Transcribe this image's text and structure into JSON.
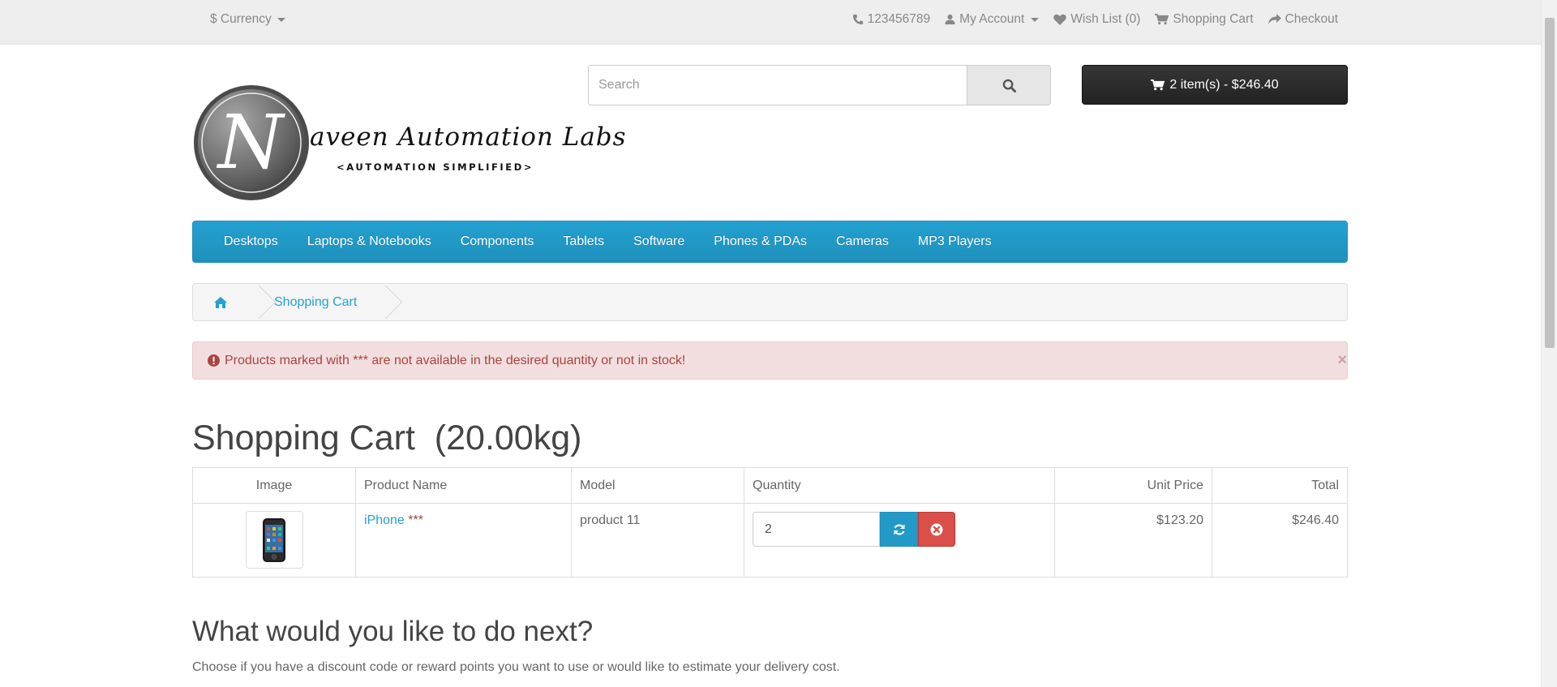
{
  "topbar": {
    "currency_label": "$ Currency",
    "phone": "123456789",
    "my_account": "My Account",
    "wish_list": "Wish List (0)",
    "shopping_cart": "Shopping Cart",
    "checkout": "Checkout"
  },
  "logo": {
    "letter": "N",
    "script_text": "aveen Automation Labs",
    "subtitle": "<AUTOMATION SIMPLIFIED>"
  },
  "search": {
    "placeholder": "Search"
  },
  "cart_button": {
    "label": "2 item(s) - $246.40"
  },
  "menu": {
    "items": [
      "Desktops",
      "Laptops & Notebooks",
      "Components",
      "Tablets",
      "Software",
      "Phones & PDAs",
      "Cameras",
      "MP3 Players"
    ]
  },
  "breadcrumb": {
    "current": "Shopping Cart"
  },
  "alert": {
    "message": "Products marked with *** are not available in the desired quantity or not in stock!",
    "close": "×"
  },
  "page": {
    "title": "Shopping Cart  (20.00kg)"
  },
  "cart_table": {
    "headers": {
      "image": "Image",
      "product_name": "Product Name",
      "model": "Model",
      "quantity": "Quantity",
      "unit_price": "Unit Price",
      "total": "Total"
    },
    "rows": [
      {
        "product_name": "iPhone",
        "stock_flag": "***",
        "model": "product 11",
        "quantity": "2",
        "unit_price": "$123.20",
        "total": "$246.40"
      }
    ]
  },
  "next": {
    "title": "What would you like to do next?",
    "description": "Choose if you have a discount code or reward points you want to use or would like to estimate your delivery cost."
  },
  "colors": {
    "menu_blue": "#229ac8",
    "link_blue": "#23a1d1",
    "alert_bg": "#f2dede",
    "alert_text": "#a94442",
    "remove_red": "#da4f49",
    "cart_button_dark": "#2d2d2d"
  },
  "icons": [
    "phone-icon",
    "user-icon",
    "heart-icon",
    "cart-icon",
    "share-icon",
    "search-icon",
    "home-icon",
    "exclamation-circle-icon",
    "refresh-icon",
    "times-circle-icon"
  ]
}
